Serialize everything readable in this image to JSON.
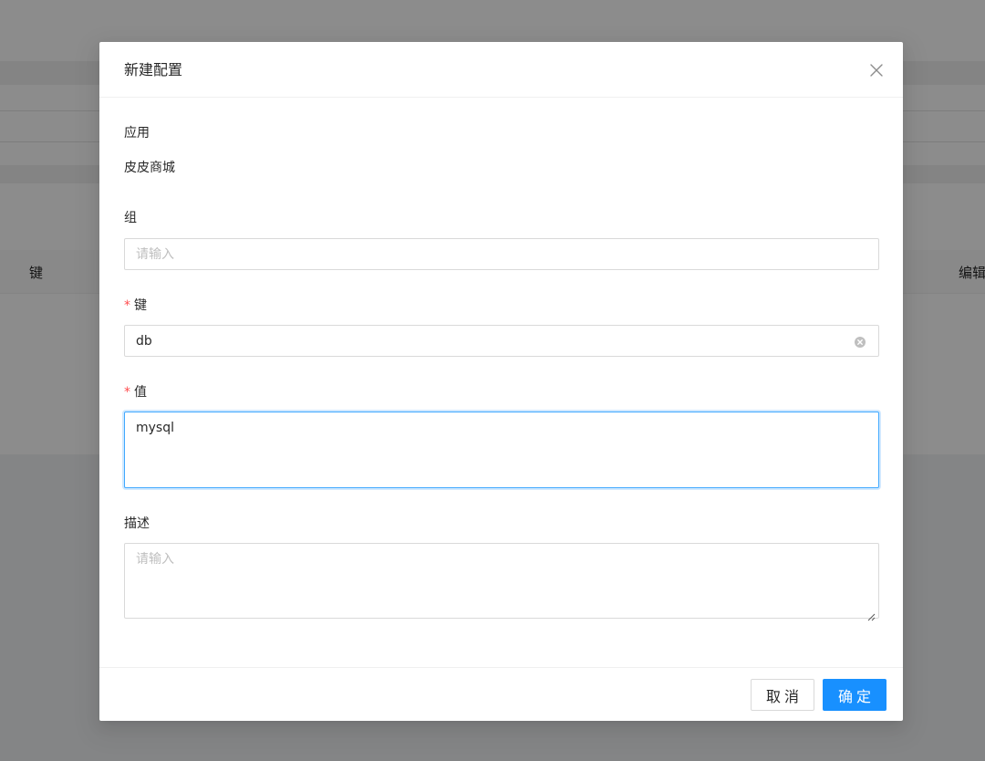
{
  "background": {
    "table_header_key": "键",
    "table_header_edit": "编辑"
  },
  "modal": {
    "title": "新建配置",
    "close_icon": "close-icon",
    "app": {
      "label": "应用",
      "value": "皮皮商城"
    },
    "group": {
      "label": "组",
      "placeholder": "请输入",
      "value": ""
    },
    "key": {
      "required_mark": "*",
      "label": "键",
      "value": "db",
      "clear_icon": "close-circle-icon"
    },
    "value": {
      "required_mark": "*",
      "label": "值",
      "value": "mysql"
    },
    "description": {
      "label": "描述",
      "placeholder": "请输入",
      "value": ""
    },
    "footer": {
      "cancel_label": "取消",
      "ok_label": "确定"
    }
  },
  "colors": {
    "primary": "#1890ff",
    "focus_border": "#40a9ff",
    "required": "#ff4d4f",
    "placeholder": "#bfbfbf",
    "mask": "rgba(0,0,0,0.45)"
  }
}
